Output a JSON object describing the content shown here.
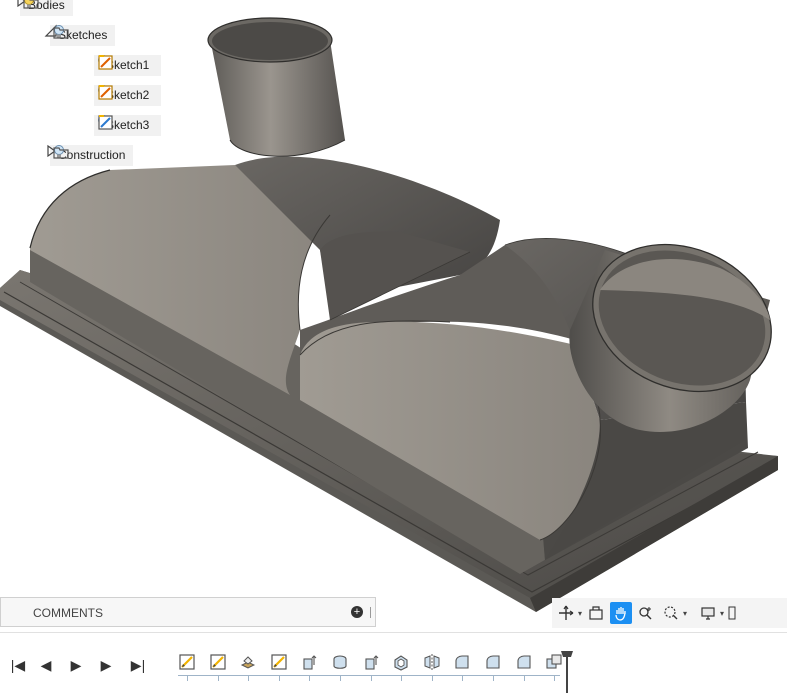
{
  "browser": {
    "items": [
      {
        "label": "Bodies",
        "expanded": false
      },
      {
        "label": "Sketches",
        "expanded": true
      },
      {
        "label": "Sketch1"
      },
      {
        "label": "Sketch2"
      },
      {
        "label": "Sketch3"
      },
      {
        "label": "Construction",
        "expanded": false
      }
    ]
  },
  "comments": {
    "title": "COMMENTS",
    "add_symbol": "+"
  },
  "navbar": {
    "icons": [
      "orbit-icon",
      "look-at-icon",
      "pan-icon",
      "zoom-icon",
      "zoom-window-icon",
      "display-settings-icon"
    ],
    "active": "pan-icon"
  },
  "playback": {
    "icons": [
      "first-icon",
      "previous-icon",
      "play-icon",
      "next-icon",
      "last-icon"
    ],
    "symbols": [
      "|◀",
      "◀",
      "▶",
      "▶",
      "▶|"
    ]
  },
  "timeline": {
    "features": [
      "sketch",
      "sketch",
      "loft",
      "sketch",
      "extrude",
      "revolve",
      "extrude",
      "shell",
      "mirror",
      "fillet",
      "fillet",
      "fillet",
      "combine"
    ]
  },
  "colors": {
    "accent": "#1c8ff2",
    "model_light": "#8f8a82",
    "model_dark": "#4e4c49",
    "sketch_icon": "#f2b400"
  }
}
